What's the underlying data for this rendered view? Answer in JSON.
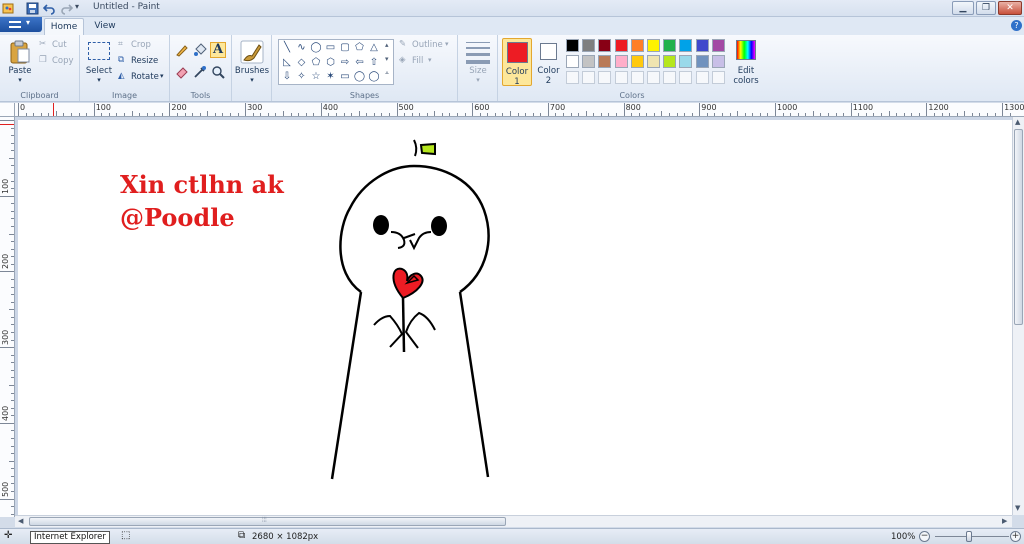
{
  "window": {
    "title": "Untitled - Paint",
    "minimize_icon": "minimize-icon",
    "maximize_icon": "restore-icon",
    "close_icon": "close-icon"
  },
  "quick_access": [
    "paint-app-icon",
    "save-icon",
    "undo-icon",
    "redo-icon",
    "customize-dropdown-icon"
  ],
  "tabs": [
    {
      "label": "Home",
      "active": true
    },
    {
      "label": "View",
      "active": false
    }
  ],
  "ribbon": {
    "clipboard": {
      "paste": "Paste",
      "cut": "Cut",
      "copy": "Copy",
      "group_label": "Clipboard"
    },
    "image": {
      "select": "Select",
      "crop": "Crop",
      "resize": "Resize",
      "rotate": "Rotate",
      "group_label": "Image"
    },
    "tools": {
      "items": [
        "pencil-icon",
        "fill-icon",
        "text-icon",
        "eraser-icon",
        "color-picker-icon",
        "magnifier-icon"
      ],
      "group_label": "Tools"
    },
    "brushes": {
      "label": "Brushes"
    },
    "shapes": {
      "glyphs": [
        "╲",
        "∿",
        "◯",
        "▭",
        "▢",
        "⬠",
        "△",
        "◺",
        "◇",
        "⬠",
        "⬡",
        "⇨",
        "⇦",
        "⇧",
        "⇩",
        "✧",
        "☆",
        "✶",
        "▭",
        "◯",
        "◯"
      ],
      "outline": "Outline",
      "fill": "Fill",
      "group_label": "Shapes"
    },
    "size": {
      "label": "Size"
    },
    "colors": {
      "color1_label": "Color",
      "color1_num": "1",
      "color1_value": "#ed1c24",
      "color2_label": "Color",
      "color2_num": "2",
      "color2_value": "#ffffff",
      "palette_row1": [
        "#000000",
        "#7f7f7f",
        "#880015",
        "#ed1c24",
        "#ff7f27",
        "#fff200",
        "#22b14c",
        "#00a2e8",
        "#3f48cc",
        "#a349a4"
      ],
      "palette_row2": [
        "#ffffff",
        "#c3c3c3",
        "#b97a57",
        "#ffaec9",
        "#ffc90e",
        "#efe4b0",
        "#b5e61d",
        "#99d9ea",
        "#7092be",
        "#c8bfe7"
      ],
      "edit_label_1": "Edit",
      "edit_label_2": "colors",
      "group_label": "Colors"
    }
  },
  "ruler": {
    "h_labels": [
      "0",
      "100",
      "200",
      "300",
      "400",
      "500",
      "600",
      "700",
      "800",
      "900",
      "1000",
      "1100",
      "1200",
      "1300"
    ],
    "v_labels": [
      "100",
      "200",
      "300",
      "400",
      "500"
    ]
  },
  "canvas": {
    "text_line1": "Xin ctlhn ak",
    "text_line2": "@Poodle",
    "text_color": "#e01e1e"
  },
  "statusbar": {
    "tooltip": "Internet Explorer",
    "dimensions": "2680 × 1082px",
    "zoom": "100%"
  }
}
